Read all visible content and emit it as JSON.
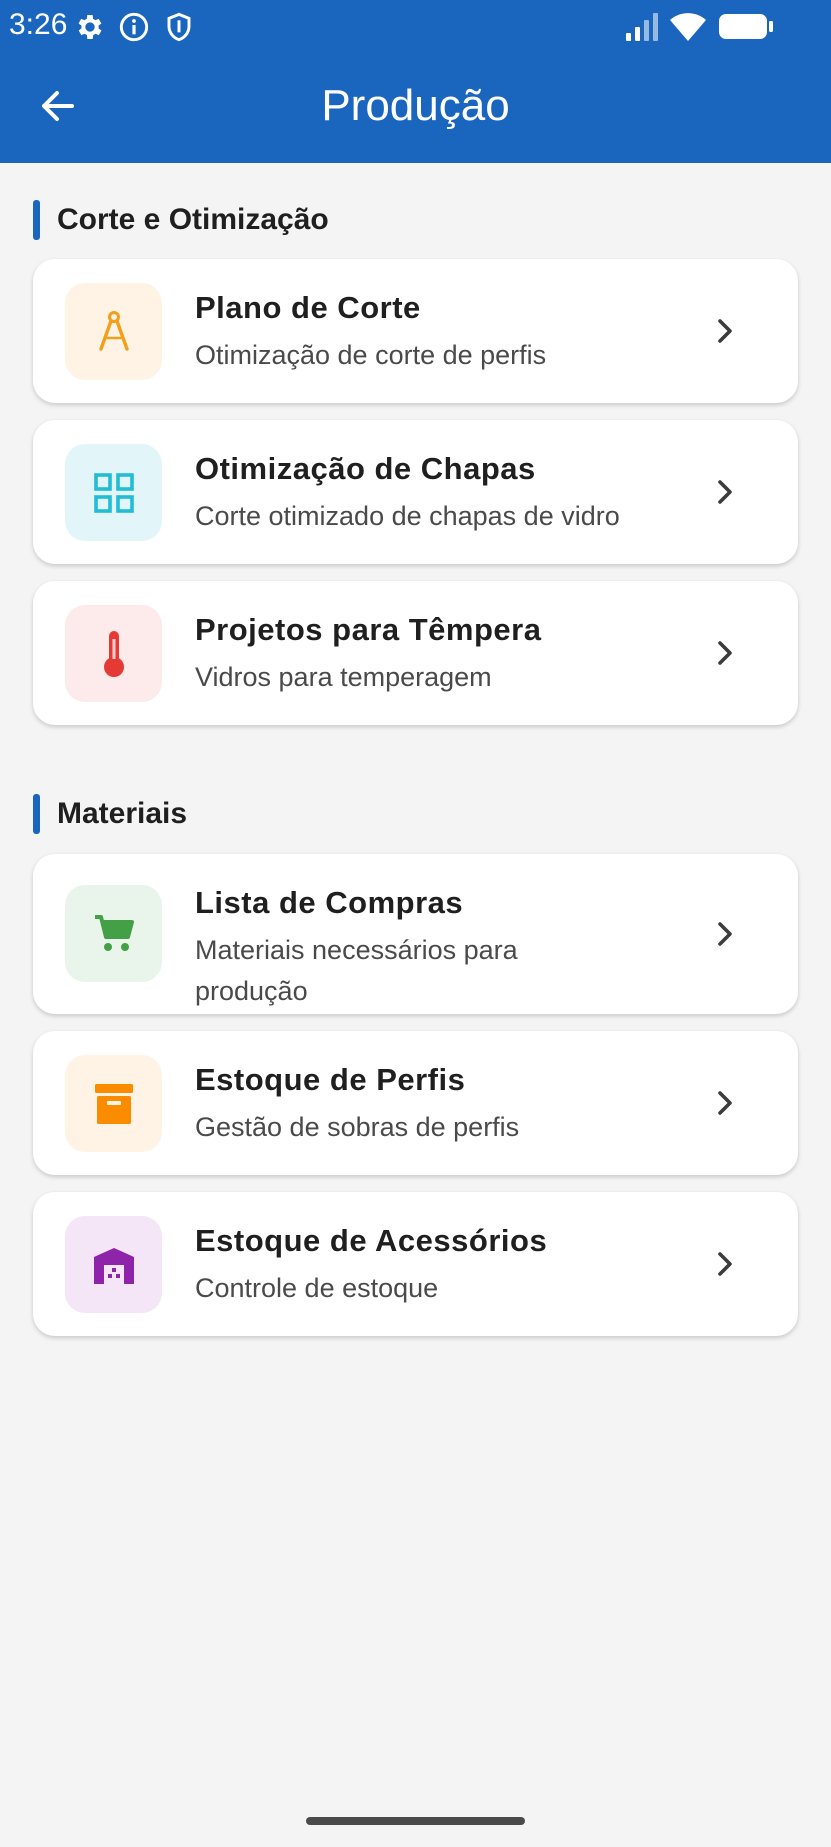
{
  "status": {
    "time": "3:26"
  },
  "header": {
    "title": "Produção"
  },
  "sections": [
    {
      "title": "Corte e Otimização",
      "items": [
        {
          "title": "Plano de Corte",
          "subtitle": "Otimização de corte de perfis",
          "icon": "compass-icon",
          "color": "#f29f19",
          "bg": "#fff3e6"
        },
        {
          "title": "Otimização de Chapas",
          "subtitle": "Corte otimizado de chapas de vidro",
          "icon": "grid-icon",
          "color": "#22bcd4",
          "bg": "#e2f6fa"
        },
        {
          "title": "Projetos para Têmpera",
          "subtitle": "Vidros para temperagem",
          "icon": "thermometer-icon",
          "color": "#e53935",
          "bg": "#fdeaea"
        }
      ]
    },
    {
      "title": "Materiais",
      "items": [
        {
          "title": "Lista de Compras",
          "subtitle": "Materiais necessários para produção",
          "icon": "cart-icon",
          "color": "#43a047",
          "bg": "#e9f4ea"
        },
        {
          "title": "Estoque de Perfis",
          "subtitle": "Gestão de sobras de perfis",
          "icon": "archive-icon",
          "color": "#fb8c00",
          "bg": "#fff3e6"
        },
        {
          "title": "Estoque de Acessórios",
          "subtitle": "Controle de estoque",
          "icon": "warehouse-icon",
          "color": "#8e24aa",
          "bg": "#f4e5f7"
        }
      ]
    }
  ]
}
